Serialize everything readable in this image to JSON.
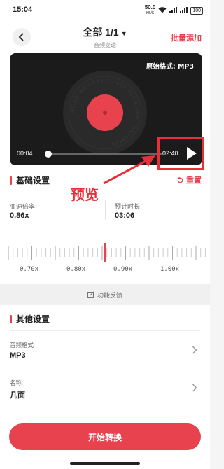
{
  "status": {
    "time": "15:04",
    "net_speed": "50.0",
    "net_unit": "KB/S",
    "battery": "100"
  },
  "header": {
    "title": "全部 1/1",
    "subtitle": "音频变速",
    "batch_add": "批量添加"
  },
  "player": {
    "format_label": "原始格式: MP3",
    "current_time": "00:04",
    "total_time": "02:40",
    "progress": 0.03,
    "disc_text": "HELLO WELCOME TO USE THE AUDIO CONVERTER"
  },
  "annotation": {
    "label": "预览"
  },
  "basic_settings": {
    "title": "基础设置",
    "reset": "重置",
    "speed_label": "变速倍率",
    "speed_value": "0.86x",
    "duration_label": "预计时长",
    "duration_value": "03:06",
    "ruler_labels": [
      "0.70x",
      "0.80x",
      "0.90x",
      "1.00x"
    ]
  },
  "feedback": {
    "label": "功能反馈"
  },
  "other_settings": {
    "title": "其他设置",
    "rows": [
      {
        "label": "音频格式",
        "value": "MP3"
      },
      {
        "label": "名称",
        "value": "几面"
      }
    ]
  },
  "start_button": {
    "label": "开始转换"
  },
  "colors": {
    "accent": "#e8424f",
    "player_bg": "#1b1b1b",
    "disc_center": "#e8424f"
  }
}
